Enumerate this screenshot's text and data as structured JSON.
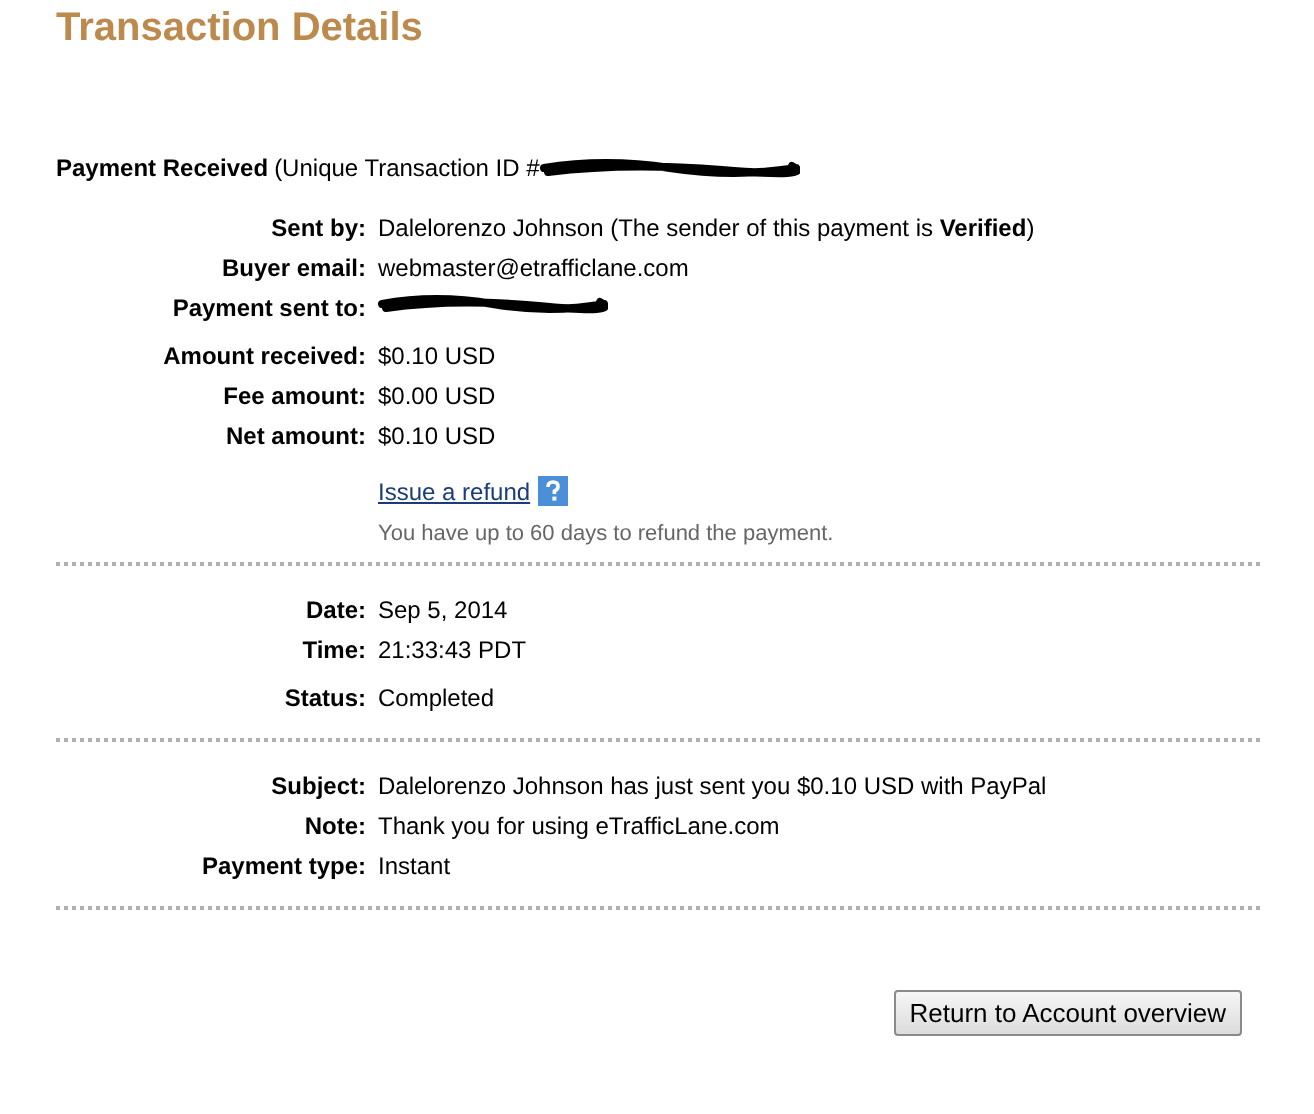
{
  "title": "Transaction Details",
  "header": {
    "label": "Payment Received",
    "detail": "(Unique Transaction ID #"
  },
  "sections": [
    {
      "rows": [
        {
          "label": "Sent by:",
          "value": "Dalelorenzo Johnson (The sender of this payment is **Verified**)"
        },
        {
          "label": "Buyer email:",
          "value": "webmaster@etrafficlane.com"
        },
        {
          "label": "Payment sent to:",
          "kind": "redacted"
        },
        {
          "label": "Amount received:",
          "value": "$0.10 USD"
        },
        {
          "label": "Fee amount:",
          "value": "$0.00 USD"
        },
        {
          "label": "Net amount:",
          "value": "$0.10 USD"
        }
      ],
      "refund": {
        "link": "Issue a refund",
        "note": "You have up to 60 days to refund the payment."
      }
    },
    {
      "rows": [
        {
          "label": "Date:",
          "value": "Sep 5, 2014"
        },
        {
          "label": "Time:",
          "value": "21:33:43 PDT"
        },
        {
          "label": "Status:",
          "value": "Completed"
        }
      ]
    },
    {
      "rows": [
        {
          "label": "Subject:",
          "value": "Dalelorenzo Johnson has just sent you $0.10 USD with PayPal"
        },
        {
          "label": "Note:",
          "value": "Thank you for using eTrafficLane.com"
        },
        {
          "label": "Payment type:",
          "value": "Instant"
        }
      ]
    }
  ],
  "button": "Return to Account overview"
}
